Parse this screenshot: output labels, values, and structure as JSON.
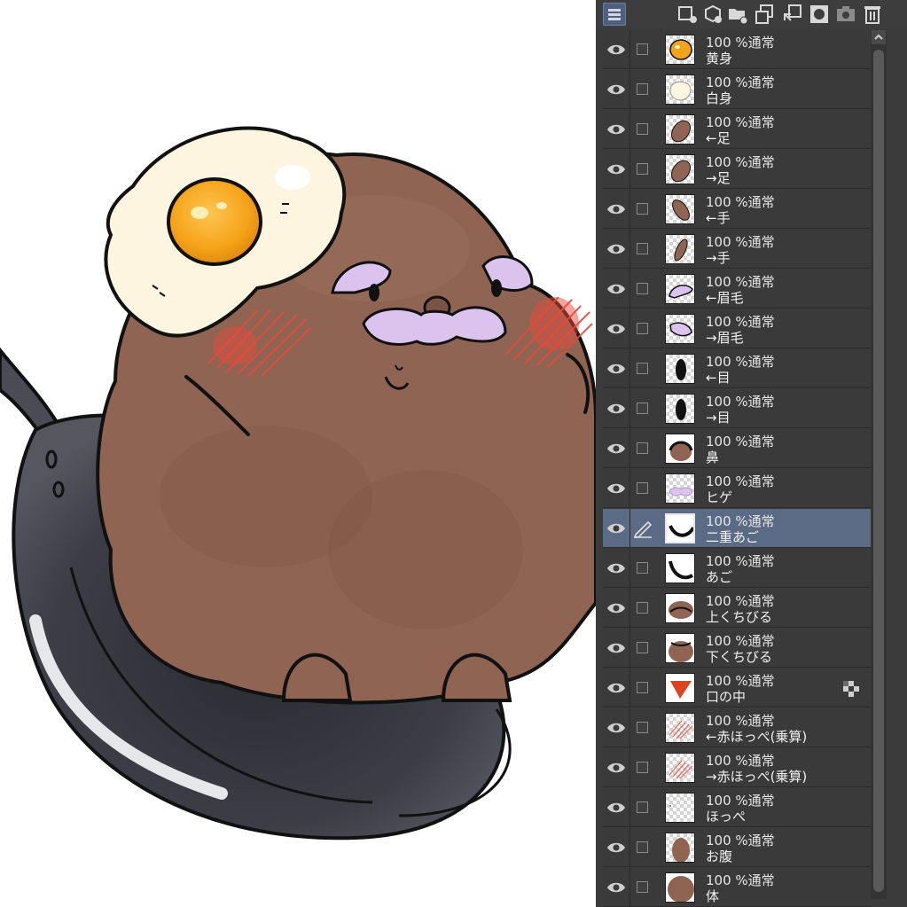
{
  "canvas": {
    "description_icon": "hamburg-character-illustration"
  },
  "toolbar": {
    "icons": [
      "panel-menu-icon",
      "new-raster-layer-icon",
      "new-3d-layer-icon",
      "new-folder-icon",
      "merge-down-icon",
      "combine-layers-icon",
      "mask-icon",
      "camera-icon",
      "trash-icon"
    ]
  },
  "colors": {
    "panel_bg": "#3b3b3b",
    "row_selected": "#5c6b85",
    "text": "#e6e6e6",
    "patty": "#8f6452",
    "yolk": "#f5a623",
    "mustache": "#dcc3ee",
    "cheek": "#e84a3a"
  },
  "layers": [
    {
      "mode": "100 %通常",
      "name": "黄身",
      "thumb": "yolk",
      "selected": false
    },
    {
      "mode": "100 %通常",
      "name": "白身",
      "thumb": "white",
      "selected": false
    },
    {
      "mode": "100 %通常",
      "name": "←足",
      "thumb": "foot",
      "selected": false
    },
    {
      "mode": "100 %通常",
      "name": "→足",
      "thumb": "foot",
      "selected": false
    },
    {
      "mode": "100 %通常",
      "name": "←手",
      "thumb": "hand",
      "selected": false
    },
    {
      "mode": "100 %通常",
      "name": "→手",
      "thumb": "hand2",
      "selected": false
    },
    {
      "mode": "100 %通常",
      "name": "←眉毛",
      "thumb": "brow",
      "selected": false
    },
    {
      "mode": "100 %通常",
      "name": "→眉毛",
      "thumb": "brow2",
      "selected": false
    },
    {
      "mode": "100 %通常",
      "name": "←目",
      "thumb": "eye",
      "selected": false
    },
    {
      "mode": "100 %通常",
      "name": "→目",
      "thumb": "eye",
      "selected": false
    },
    {
      "mode": "100 %通常",
      "name": "鼻",
      "thumb": "nose",
      "selected": false
    },
    {
      "mode": "100 %通常",
      "name": "ヒゲ",
      "thumb": "beard",
      "selected": false
    },
    {
      "mode": "100 %通常",
      "name": "二重あご",
      "thumb": "chin",
      "selected": true
    },
    {
      "mode": "100 %通常",
      "name": "あご",
      "thumb": "chin2",
      "selected": false
    },
    {
      "mode": "100 %通常",
      "name": "上くちびる",
      "thumb": "lip",
      "selected": false
    },
    {
      "mode": "100 %通常",
      "name": "下くちびる",
      "thumb": "lip2",
      "selected": false
    },
    {
      "mode": "100 %通常",
      "name": "口の中",
      "thumb": "mouth",
      "selected": false,
      "locked": true
    },
    {
      "mode": "100 %通常",
      "name": "←赤ほっぺ(乗算)",
      "thumb": "cheek",
      "selected": false
    },
    {
      "mode": "100 %通常",
      "name": "→赤ほっぺ(乗算)",
      "thumb": "cheek",
      "selected": false
    },
    {
      "mode": "100 %通常",
      "name": "ほっぺ",
      "thumb": "empty",
      "selected": false
    },
    {
      "mode": "100 %通常",
      "name": "お腹",
      "thumb": "belly",
      "selected": false
    },
    {
      "mode": "100 %通常",
      "name": "体",
      "thumb": "body",
      "selected": false
    }
  ]
}
